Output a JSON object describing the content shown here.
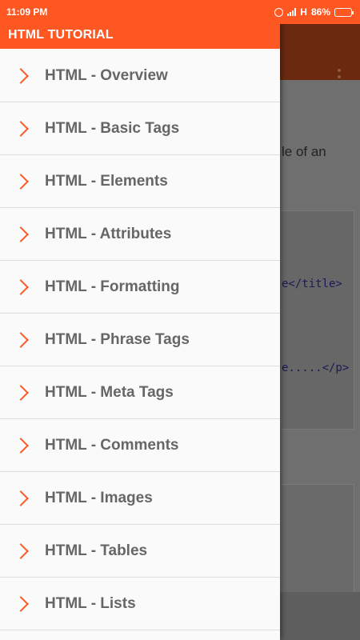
{
  "status_bar": {
    "time": "11:09 PM",
    "network": "H",
    "battery": "86%",
    "battery_level": 0.86
  },
  "drawer": {
    "title": "HTML TUTORIAL",
    "items": [
      {
        "label": "HTML - Overview"
      },
      {
        "label": "HTML - Basic Tags"
      },
      {
        "label": "HTML - Elements"
      },
      {
        "label": "HTML - Attributes"
      },
      {
        "label": "HTML - Formatting"
      },
      {
        "label": "HTML - Phrase Tags"
      },
      {
        "label": "HTML - Meta Tags"
      },
      {
        "label": "HTML - Comments"
      },
      {
        "label": "HTML - Images"
      },
      {
        "label": "HTML - Tables"
      },
      {
        "label": "HTML - Lists"
      }
    ]
  },
  "background": {
    "text_fragment": "le of an",
    "code_lines": [
      "e</title>",
      "e.....</p>"
    ]
  },
  "colors": {
    "accent": "#ff5722",
    "drawer_bg": "#fafafa",
    "item_text": "#666666"
  },
  "icons": {
    "drawer_item": "chevron-right-icon",
    "toolbar_menu": "overflow-menu-icon"
  }
}
